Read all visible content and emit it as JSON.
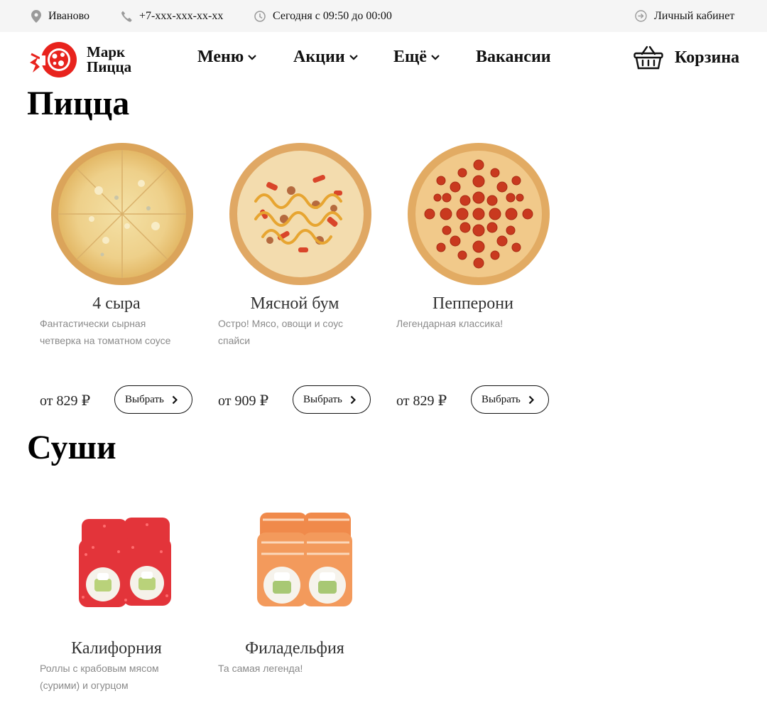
{
  "topbar": {
    "city": "Иваново",
    "phone": "+7-xxx-xxx-xx-xx",
    "hours": "Сегодня с 09:50 до 00:00",
    "account": "Личный кабинет"
  },
  "header": {
    "logo_line1": "Марк",
    "logo_line2": "Пицца",
    "nav": [
      {
        "label": "Меню"
      },
      {
        "label": "Акции"
      },
      {
        "label": "Ещё"
      },
      {
        "label": "Вакансии"
      }
    ],
    "cart_label": "Корзина"
  },
  "colors": {
    "brand": "#e8231d",
    "topbar_bg": "#f5f5f5"
  },
  "sections": [
    {
      "title": "Пицца",
      "items": [
        {
          "name": "4 сыра",
          "desc": "Фантастически сырная четверка на томатном соусе",
          "price": "от 829 ₽",
          "button": "Выбрать",
          "image": "pizza-four-cheese"
        },
        {
          "name": "Мясной бум",
          "desc": "Остро! Мясо, овощи и соус спайси",
          "price": "от 909 ₽",
          "button": "Выбрать",
          "image": "pizza-meat-boom"
        },
        {
          "name": "Пепперони",
          "desc": "Легендарная классика!",
          "price": "от 829 ₽",
          "button": "Выбрать",
          "image": "pizza-pepperoni"
        }
      ]
    },
    {
      "title": "Суши",
      "items": [
        {
          "name": "Калифорния",
          "desc": "Роллы с крабовым мясом (сурими) и огурцом",
          "image": "sushi-california"
        },
        {
          "name": "Филадельфия",
          "desc": "Та самая легенда!",
          "image": "sushi-philadelphia"
        }
      ]
    }
  ]
}
